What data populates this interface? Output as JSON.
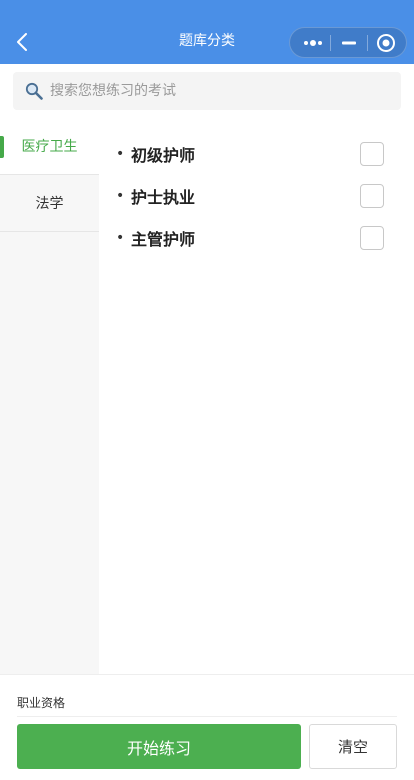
{
  "navbar": {
    "title": "题库分类",
    "back_icon": "chevron-left-icon",
    "capsule_icons": [
      "more-dots-icon",
      "minimize-icon",
      "target-close-icon"
    ],
    "background": "#4a8fe7"
  },
  "search": {
    "placeholder": "搜索您想练习的考试",
    "value": "",
    "icon": "magnifier-icon"
  },
  "sidebar": {
    "items": [
      {
        "label": "医疗卫生",
        "active": true
      },
      {
        "label": "法学",
        "active": false
      }
    ],
    "active_color": "#45a949"
  },
  "categories": [
    {
      "label": "初级护师",
      "checked": false
    },
    {
      "label": "护士执业",
      "checked": false
    },
    {
      "label": "主管护师",
      "checked": false
    }
  ],
  "bullet": "•",
  "footer": {
    "label": "职业资格",
    "start_button": "开始练习",
    "clear_button": "清空",
    "start_color": "#4caf50"
  }
}
